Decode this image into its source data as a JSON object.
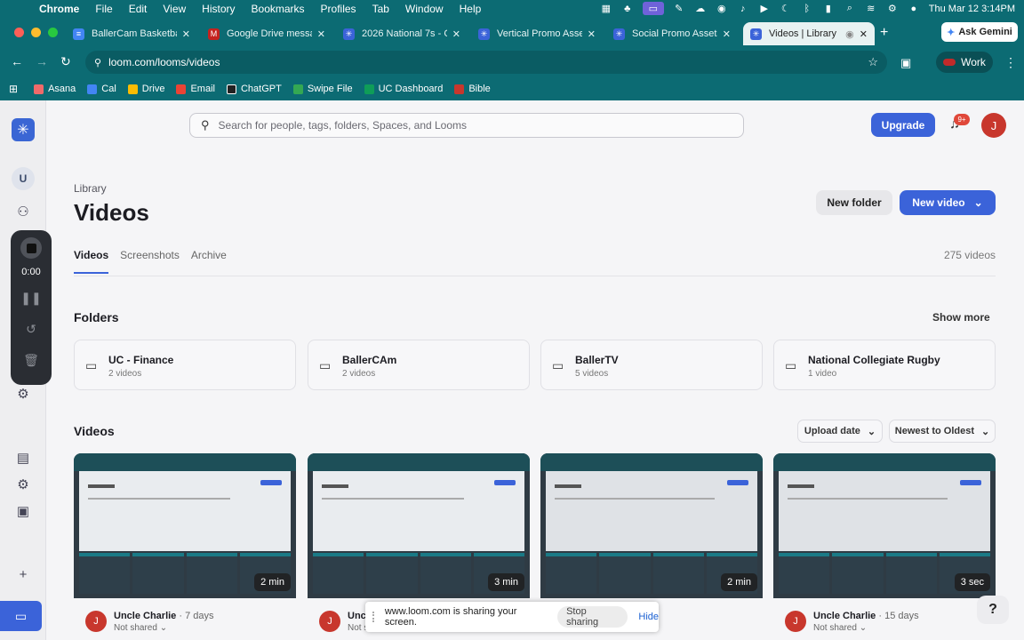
{
  "menubar": {
    "app_name": "Chrome",
    "items": [
      "File",
      "Edit",
      "View",
      "History",
      "Bookmarks",
      "Profiles",
      "Tab",
      "Window",
      "Help"
    ],
    "clock": "Thu Mar 12  3:14PM"
  },
  "tabs": [
    {
      "title": "BallerCam Basketball",
      "icon": "google-docs-icon",
      "color": "#4285f4",
      "active": false
    },
    {
      "title": "Google Drive message",
      "icon": "gmail-icon",
      "color": "#c5221f",
      "active": false
    },
    {
      "title": "2026 National 7s - C",
      "icon": "loom-icon",
      "color": "#3b63d9",
      "active": false
    },
    {
      "title": "Vertical Promo Asset",
      "icon": "loom-icon",
      "color": "#3b63d9",
      "active": false
    },
    {
      "title": "Social Promo Assets",
      "icon": "loom-icon",
      "color": "#3b63d9",
      "active": false
    },
    {
      "title": "Videos | Library |",
      "icon": "loom-icon",
      "color": "#3b63d9",
      "active": true
    }
  ],
  "ask_gemini": "Ask Gemini",
  "address": "loom.com/looms/videos",
  "profile": "Work",
  "bookmarks": [
    {
      "label": "Asana",
      "color": "#f06a6a"
    },
    {
      "label": "Cal",
      "color": "#4285f4"
    },
    {
      "label": "Drive",
      "color": "#fbbc04"
    },
    {
      "label": "Email",
      "color": "#ea4335"
    },
    {
      "label": "ChatGPT",
      "color": "#222222"
    },
    {
      "label": "Swipe File",
      "color": "#34a853"
    },
    {
      "label": "UC Dashboard",
      "color": "#0f9d58"
    },
    {
      "label": "Bible",
      "color": "#c8372d"
    }
  ],
  "rail": {
    "workspace_initial": "U"
  },
  "recorder": {
    "timer": "0:00"
  },
  "search": {
    "placeholder": "Search for people, tags, folders, Spaces, and Looms"
  },
  "header": {
    "upgrade": "Upgrade",
    "notif_badge": "9+",
    "avatar_initial": "J"
  },
  "page": {
    "breadcrumb": "Library",
    "title": "Videos",
    "new_folder": "New folder",
    "new_video": "New video",
    "tabs": [
      "Videos",
      "Screenshots",
      "Archive"
    ],
    "count": "275 videos"
  },
  "folders_section": {
    "heading": "Folders",
    "show_more": "Show more",
    "items": [
      {
        "name": "UC - Finance",
        "sub": "2 videos"
      },
      {
        "name": "BallerCAm",
        "sub": "2 videos"
      },
      {
        "name": "BallerTV",
        "sub": "5 videos"
      },
      {
        "name": "National Collegiate Rugby",
        "sub": "1 video"
      }
    ]
  },
  "videos_section": {
    "heading": "Videos",
    "sort_field": "Upload date",
    "sort_order": "Newest to Oldest",
    "items": [
      {
        "owner": "Uncle Charlie",
        "ago": "· 7 days",
        "shared": "Not shared ⌄",
        "duration": "2 min",
        "initial": "J"
      },
      {
        "owner": "Uncle Charlie",
        "ago": "",
        "shared": "Not shared",
        "duration": "3 min",
        "initial": "J"
      },
      {
        "owner": "",
        "ago": "",
        "shared": "",
        "duration": "2 min",
        "initial": ""
      },
      {
        "owner": "Uncle Charlie",
        "ago": "· 15 days",
        "shared": "Not shared ⌄",
        "duration": "3 sec",
        "initial": "J"
      }
    ]
  },
  "sharebar": {
    "message": "www.loom.com is sharing your screen.",
    "stop": "Stop sharing",
    "hide": "Hide"
  },
  "help": "?"
}
